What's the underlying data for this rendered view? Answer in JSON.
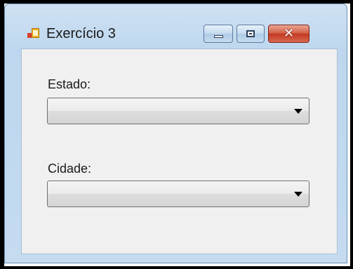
{
  "window": {
    "title": "Exercício 3",
    "icon": "form-app-icon",
    "controls": {
      "minimize": "minimize-icon",
      "maximize": "maximize-icon",
      "close": "close-icon"
    }
  },
  "form": {
    "estado": {
      "label": "Estado:",
      "value": ""
    },
    "cidade": {
      "label": "Cidade:",
      "value": ""
    }
  },
  "colors": {
    "titlebar": "#c4dbf0",
    "client": "#f0f0f0",
    "close_button": "#c33a22"
  }
}
